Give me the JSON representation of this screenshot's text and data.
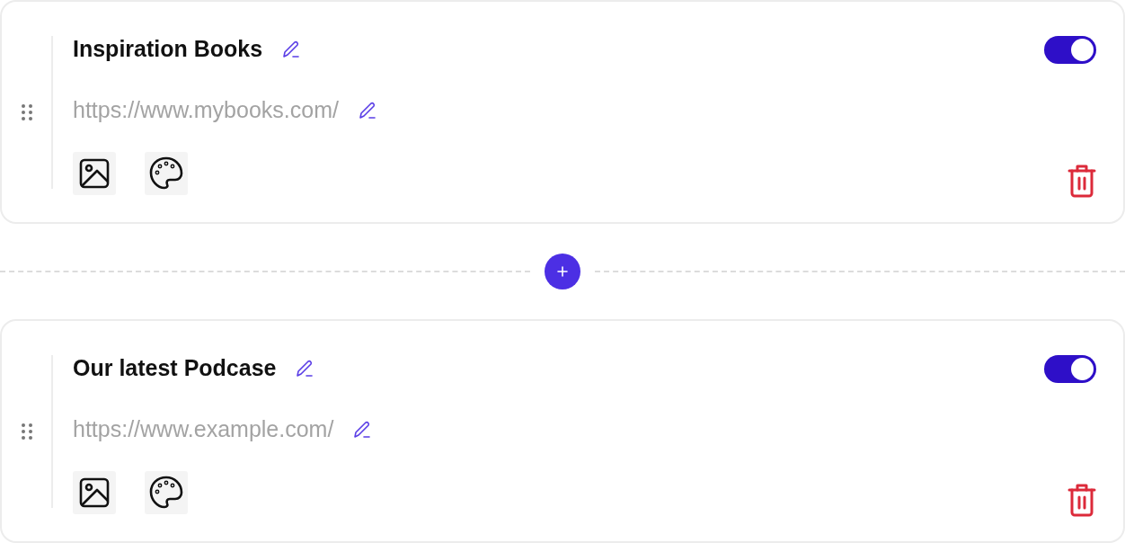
{
  "links": [
    {
      "title": "Inspiration Books",
      "url": "https://www.mybooks.com/",
      "enabled": true
    },
    {
      "title": "Our latest Podcase",
      "url": "https://www.example.com/",
      "enabled": true
    }
  ]
}
